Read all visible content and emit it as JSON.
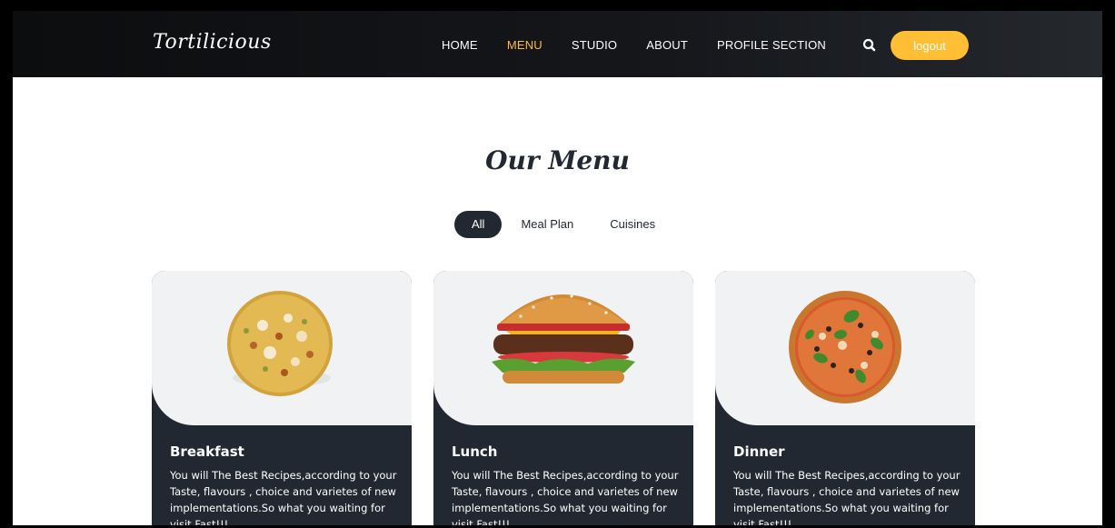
{
  "header": {
    "brand": "Tortilicious",
    "nav": [
      {
        "label": "HOME"
      },
      {
        "label": "MENU",
        "active": true
      },
      {
        "label": "STUDIO"
      },
      {
        "label": "ABOUT"
      },
      {
        "label": "PROFILE SECTION"
      }
    ],
    "search_icon": "search-icon",
    "logout_label": "logout"
  },
  "section": {
    "title": "Our Menu",
    "filters": [
      {
        "label": "All",
        "active": true
      },
      {
        "label": "Meal Plan"
      },
      {
        "label": "Cuisines"
      }
    ]
  },
  "cards": [
    {
      "title": "Breakfast",
      "description": "You will The Best Recipes,according to your Taste, flavours , choice and varietes of new implementations.So what you waiting for visit Fast!!!",
      "image": "breakfast-tortilla-image"
    },
    {
      "title": "Lunch",
      "description": "You will The Best Recipes,according to your Taste, flavours , choice and varietes of new implementations.So what you waiting for visit Fast!!!",
      "image": "burger-image"
    },
    {
      "title": "Dinner",
      "description": "You will The Best Recipes,according to your Taste, flavours , choice and varietes of new implementations.So what you waiting for visit Fast!!!",
      "image": "pizza-image"
    }
  ],
  "colors": {
    "accent": "#ffbe33",
    "dark": "#222831",
    "card_image_bg": "#f1f2f3"
  }
}
